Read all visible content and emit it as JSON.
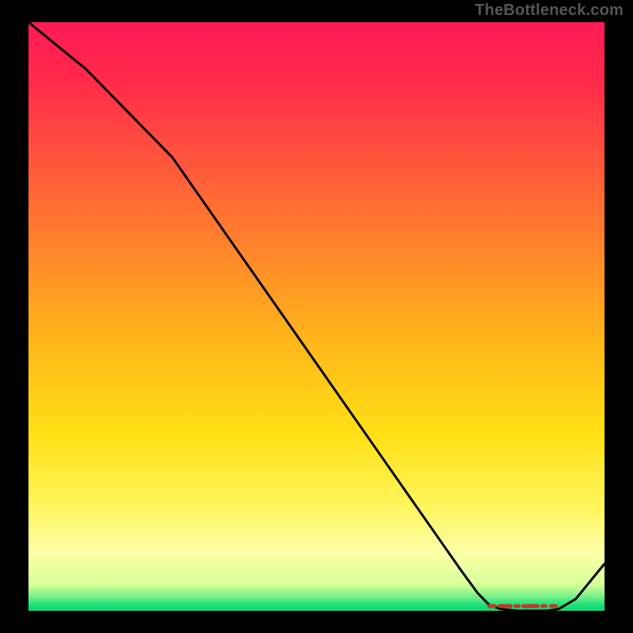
{
  "attribution": "TheBottleneck.com",
  "chart_data": {
    "type": "line",
    "title": "",
    "xlabel": "",
    "ylabel": "",
    "axes_hidden": true,
    "note": "No numeric axes or labels are rendered; curve shape estimated from pixel geometry.",
    "x_range": [
      0,
      100
    ],
    "y_range": [
      0,
      100
    ],
    "series": [
      {
        "name": "curve",
        "x": [
          0,
          5,
          10,
          15,
          20,
          25,
          30,
          35,
          40,
          45,
          50,
          55,
          60,
          65,
          70,
          75,
          78,
          80,
          82,
          85,
          88,
          90,
          92,
          95,
          100
        ],
        "y": [
          100,
          96,
          92,
          87,
          82,
          77,
          70,
          63,
          56,
          49,
          42,
          35,
          28,
          21,
          14,
          7,
          3,
          1,
          0.3,
          0,
          0,
          0,
          0.3,
          2,
          8
        ]
      }
    ],
    "flat_region": {
      "x_start": 80,
      "x_end": 92,
      "note": "Short dashed red segment along the bottom where the curve flattens."
    },
    "background": {
      "description": "Vertical gradient: bright pink/red top → orange → yellow → very thin green strip at bottom.",
      "stops": [
        {
          "pos": 0.0,
          "color": "#ff1a55"
        },
        {
          "pos": 0.1,
          "color": "#ff2a4a"
        },
        {
          "pos": 0.25,
          "color": "#ff5a3a"
        },
        {
          "pos": 0.4,
          "color": "#ff8a2a"
        },
        {
          "pos": 0.55,
          "color": "#ffb81a"
        },
        {
          "pos": 0.7,
          "color": "#ffe015"
        },
        {
          "pos": 0.82,
          "color": "#fff55a"
        },
        {
          "pos": 0.9,
          "color": "#feffa8"
        },
        {
          "pos": 0.955,
          "color": "#d8ff9a"
        },
        {
          "pos": 0.975,
          "color": "#7af08a"
        },
        {
          "pos": 0.99,
          "color": "#1fe07a"
        },
        {
          "pos": 1.0,
          "color": "#0cd46e"
        }
      ]
    }
  }
}
